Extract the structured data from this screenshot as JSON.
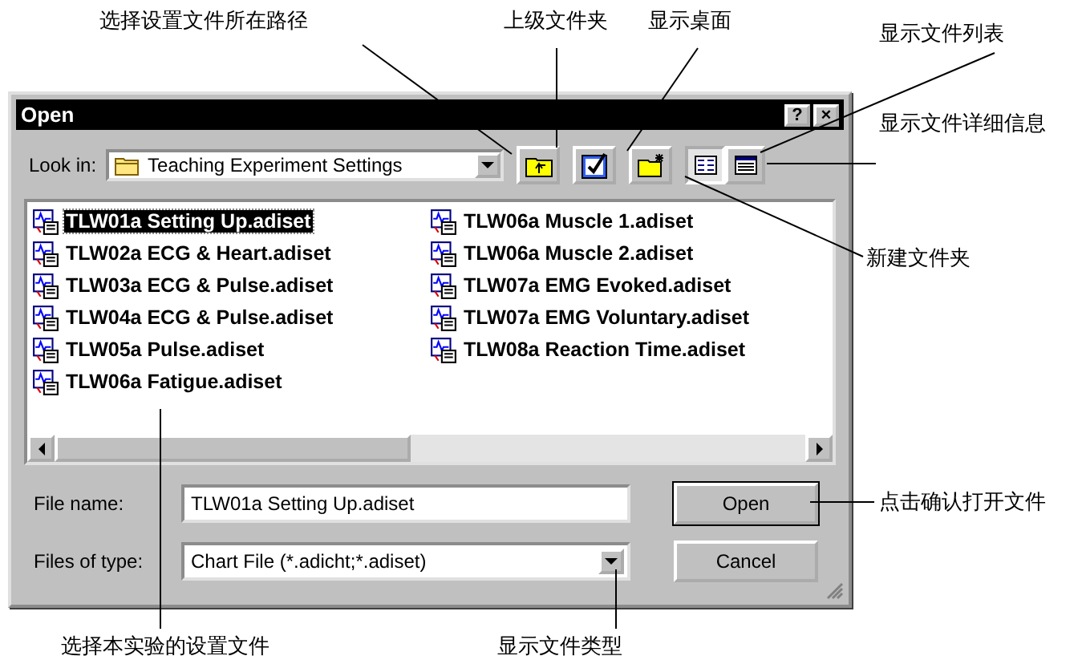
{
  "window": {
    "title": "Open",
    "title_buttons": [
      "?",
      "×"
    ]
  },
  "look_in": {
    "label": "Look in:",
    "value": "Teaching Experiment Settings"
  },
  "view_buttons": [
    {
      "kind": "list",
      "selected": true
    },
    {
      "kind": "details",
      "selected": false
    }
  ],
  "files": [
    {
      "name": "TLW01a Setting Up.adiset",
      "selected": true
    },
    {
      "name": "TLW02a ECG & Heart.adiset",
      "selected": false
    },
    {
      "name": "TLW03a ECG & Pulse.adiset",
      "selected": false
    },
    {
      "name": "TLW04a ECG & Pulse.adiset",
      "selected": false
    },
    {
      "name": "TLW05a Pulse.adiset",
      "selected": false
    },
    {
      "name": "TLW06a Fatigue.adiset",
      "selected": false
    },
    {
      "name": "TLW06a Muscle 1.adiset",
      "selected": false
    },
    {
      "name": "TLW06a Muscle 2.adiset",
      "selected": false
    },
    {
      "name": "TLW07a EMG Evoked.adiset",
      "selected": false
    },
    {
      "name": "TLW07a EMG Voluntary.adiset",
      "selected": false
    },
    {
      "name": "TLW08a Reaction Time.adiset",
      "selected": false
    }
  ],
  "file_name": {
    "label": "File name:",
    "value": "TLW01a Setting Up.adiset"
  },
  "file_type": {
    "label": "Files of type:",
    "value": "Chart File (*.adicht;*.adiset)"
  },
  "buttons": [
    {
      "label": "Open",
      "default": true
    },
    {
      "label": "Cancel",
      "default": false
    }
  ],
  "callouts": [
    "选择设置文件所在路径",
    "上级文件夹",
    "显示桌面",
    "显示文件列表",
    "显示文件详细信息",
    "新建文件夹",
    "点击确认打开文件",
    "选择本实验的设置文件",
    "显示文件类型"
  ]
}
